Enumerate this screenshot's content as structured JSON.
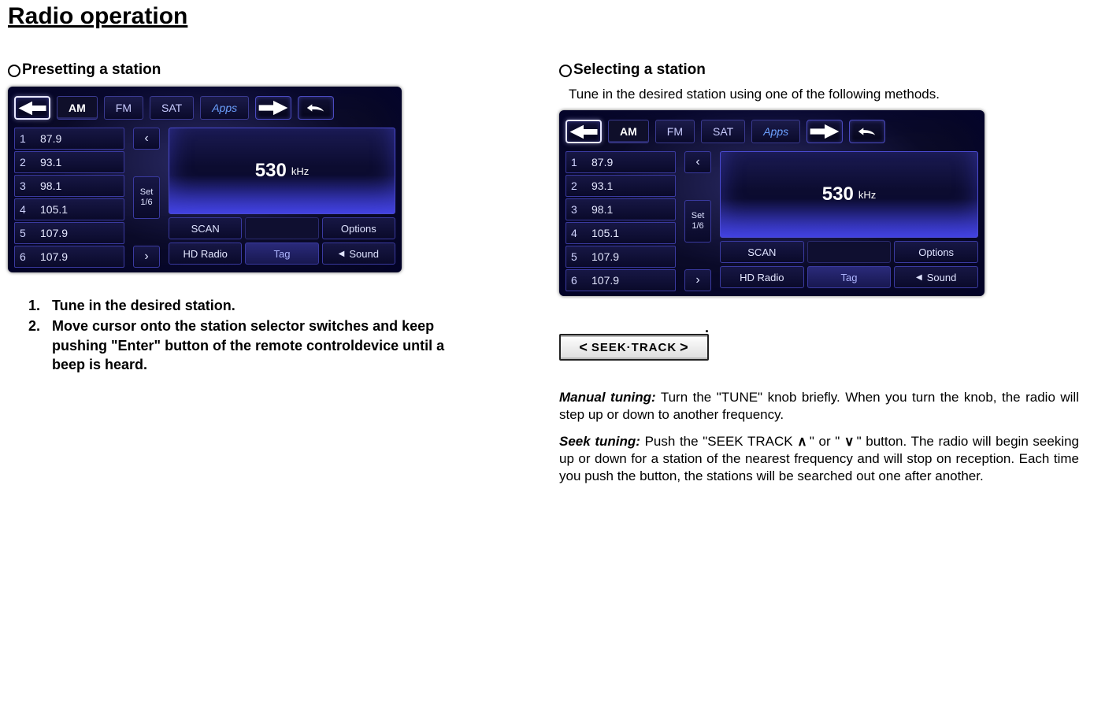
{
  "page_title": "Radio operation",
  "left": {
    "heading": "Presetting a station",
    "instructions": [
      "Tune in the desired station.",
      "Move cursor onto the station selector switches and keep pushing  \"Enter\" button of the remote controldevice until a beep is heard."
    ]
  },
  "right": {
    "heading": "Selecting a station",
    "intro": "Tune in the desired station using one of the following methods.",
    "seek_label": "SEEK·TRACK",
    "manual": {
      "label": "Manual tuning:",
      "text": " Turn the \"TUNE\" knob briefly.  When you turn the knob, the radio will step up or down to another frequency."
    },
    "seek": {
      "label": "Seek tuning:",
      "text_a": " Push the \"SEEK TRACK ",
      "up": "∧",
      "mid": " \" or \" ",
      "down": "∨",
      "text_b": " \" button. The radio will begin seeking up or down for a station of the nearest frequency and will stop on reception.  Each time you push the button, the stations will be searched out one after another."
    }
  },
  "radio": {
    "tabs": {
      "am": "AM",
      "fm": "FM",
      "sat": "SAT",
      "apps": "Apps"
    },
    "presets": [
      {
        "n": "1",
        "f": "87.9"
      },
      {
        "n": "2",
        "f": "93.1"
      },
      {
        "n": "3",
        "f": "98.1"
      },
      {
        "n": "4",
        "f": "105.1"
      },
      {
        "n": "5",
        "f": "107.9"
      },
      {
        "n": "6",
        "f": "107.9"
      }
    ],
    "set_line1": "Set",
    "set_line2": "1/6",
    "freq": "530",
    "freq_unit": "kHz",
    "buttons": {
      "scan": "SCAN",
      "options": "Options",
      "hd": "HD Radio",
      "tag": "Tag",
      "sound": "Sound"
    }
  }
}
